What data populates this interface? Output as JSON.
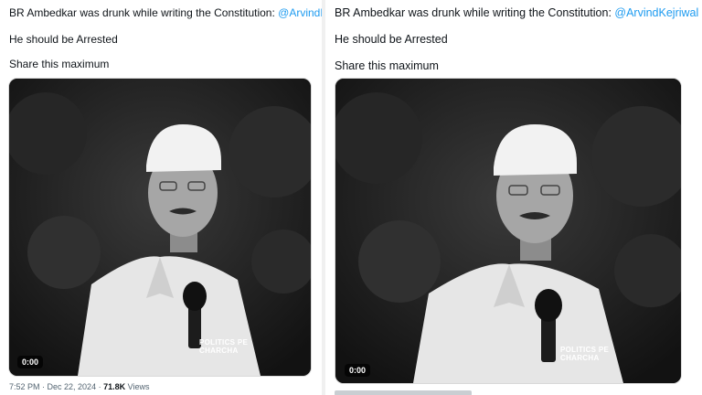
{
  "tweets": [
    {
      "line1_text": "BR Ambedkar was drunk while writing the Constitution: ",
      "mention": "@ArvindKejriwal",
      "line2": "He should be Arrested",
      "line3": "Share this maximum",
      "video_duration": "0:00",
      "watermark_line1": "POLITICS PE",
      "watermark_line2": "CHARCHA",
      "time": "7:52 PM",
      "separator": " · ",
      "date": "Dec 22, 2024",
      "views_count": "71.8K",
      "views_label": " Views"
    },
    {
      "line1_text": "BR Ambedkar was drunk while writing the Constitution: ",
      "mention": "@ArvindKejriwal",
      "line2": "He should be Arrested",
      "line3": "Share this maximum",
      "video_duration": "0:00",
      "watermark_line1": "POLITICS PE",
      "watermark_line2": "CHARCHA"
    }
  ],
  "colors": {
    "mention": "#1d9bf0",
    "text": "#0f1419",
    "meta": "#536471"
  }
}
